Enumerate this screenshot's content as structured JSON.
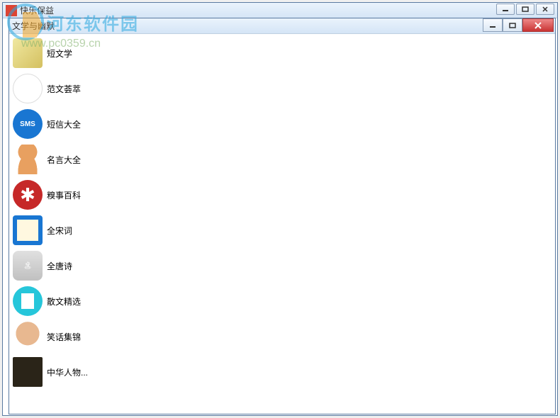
{
  "outer_window": {
    "title": "快乐保益"
  },
  "inner_window": {
    "title": "文学与幽默"
  },
  "list": {
    "items": [
      {
        "label": "短文学",
        "icon": "scroll"
      },
      {
        "label": "范文荟萃",
        "icon": "palette"
      },
      {
        "label": "短信大全",
        "icon": "sms",
        "badge": "SMS"
      },
      {
        "label": "名言大全",
        "icon": "person"
      },
      {
        "label": "糗事百科",
        "icon": "triskelion"
      },
      {
        "label": "全宋词",
        "icon": "book"
      },
      {
        "label": "全唐诗",
        "icon": "island"
      },
      {
        "label": "散文精选",
        "icon": "document"
      },
      {
        "label": "笑话集锦",
        "icon": "face"
      },
      {
        "label": "中华人物...",
        "icon": "painting"
      }
    ]
  },
  "watermark": {
    "brand": "河东软件园",
    "url": "www.pc0359.cn"
  }
}
